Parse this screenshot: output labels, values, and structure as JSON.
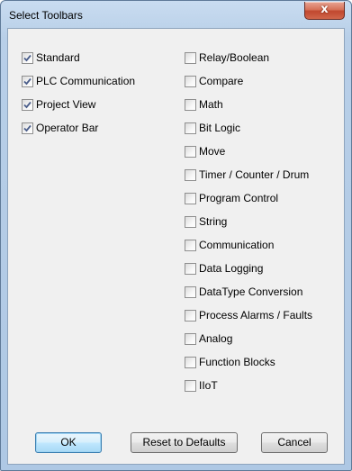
{
  "dialog": {
    "title": "Select Toolbars",
    "close_glyph": "x"
  },
  "left_column": [
    {
      "label": "Standard",
      "checked": true
    },
    {
      "label": "PLC Communication",
      "checked": true
    },
    {
      "label": "Project View",
      "checked": true
    },
    {
      "label": "Operator Bar",
      "checked": true
    }
  ],
  "right_column": [
    {
      "label": "Relay/Boolean",
      "checked": false
    },
    {
      "label": "Compare",
      "checked": false
    },
    {
      "label": "Math",
      "checked": false
    },
    {
      "label": "Bit Logic",
      "checked": false
    },
    {
      "label": "Move",
      "checked": false
    },
    {
      "label": "Timer / Counter / Drum",
      "checked": false
    },
    {
      "label": "Program Control",
      "checked": false
    },
    {
      "label": "String",
      "checked": false
    },
    {
      "label": "Communication",
      "checked": false
    },
    {
      "label": "Data Logging",
      "checked": false
    },
    {
      "label": "DataType Conversion",
      "checked": false
    },
    {
      "label": "Process Alarms / Faults",
      "checked": false
    },
    {
      "label": "Analog",
      "checked": false
    },
    {
      "label": "Function Blocks",
      "checked": false
    },
    {
      "label": "IIoT",
      "checked": false
    }
  ],
  "buttons": {
    "ok": "OK",
    "reset": "Reset to Defaults",
    "cancel": "Cancel"
  },
  "colors": {
    "frame": "#aec8e4",
    "client": "#f0f0f0",
    "close_button": "#c1482f",
    "check_mark": "#4a5d8a"
  }
}
